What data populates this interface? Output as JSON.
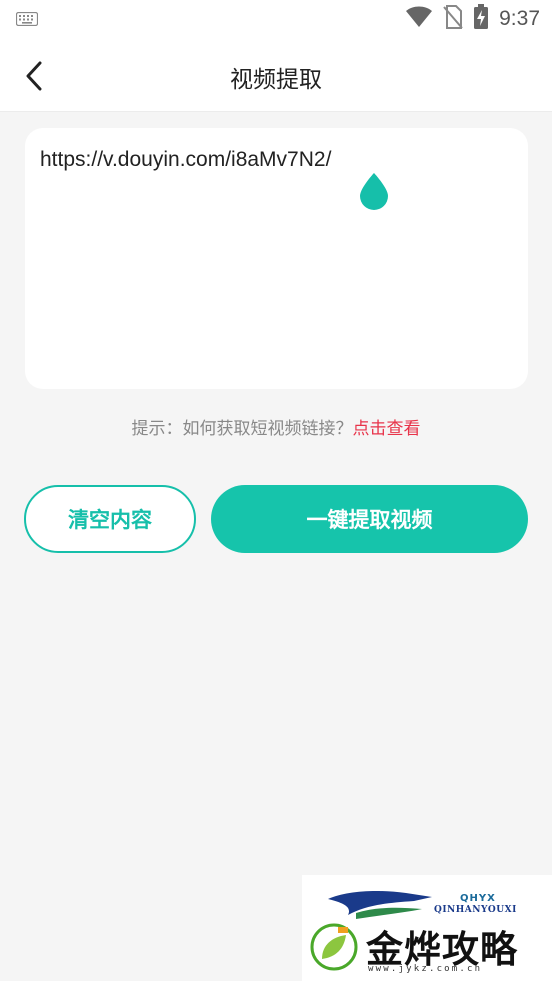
{
  "status_bar": {
    "time": "9:37",
    "icons": [
      "keyboard-icon",
      "wifi-icon",
      "no-sim-icon",
      "battery-charging-icon"
    ]
  },
  "app_bar": {
    "back_icon": "chevron-left-icon",
    "title": "视频提取"
  },
  "url_input": {
    "value": "https://v.douyin.com/i8aMv7N2/"
  },
  "hint": {
    "prefix": "提示：如何获取短视频链接？",
    "link": "点击查看"
  },
  "actions": {
    "clear_label": "清空内容",
    "extract_label": "一键提取视频"
  },
  "watermark": {
    "brand_top": "QHYX",
    "brand_sub": "QINHANYOUXI",
    "name": "金烨攻略网",
    "site": "www.jykz.com.cn"
  },
  "colors": {
    "accent": "#16c4ab",
    "link": "#e8344a",
    "background": "#f5f5f5"
  }
}
